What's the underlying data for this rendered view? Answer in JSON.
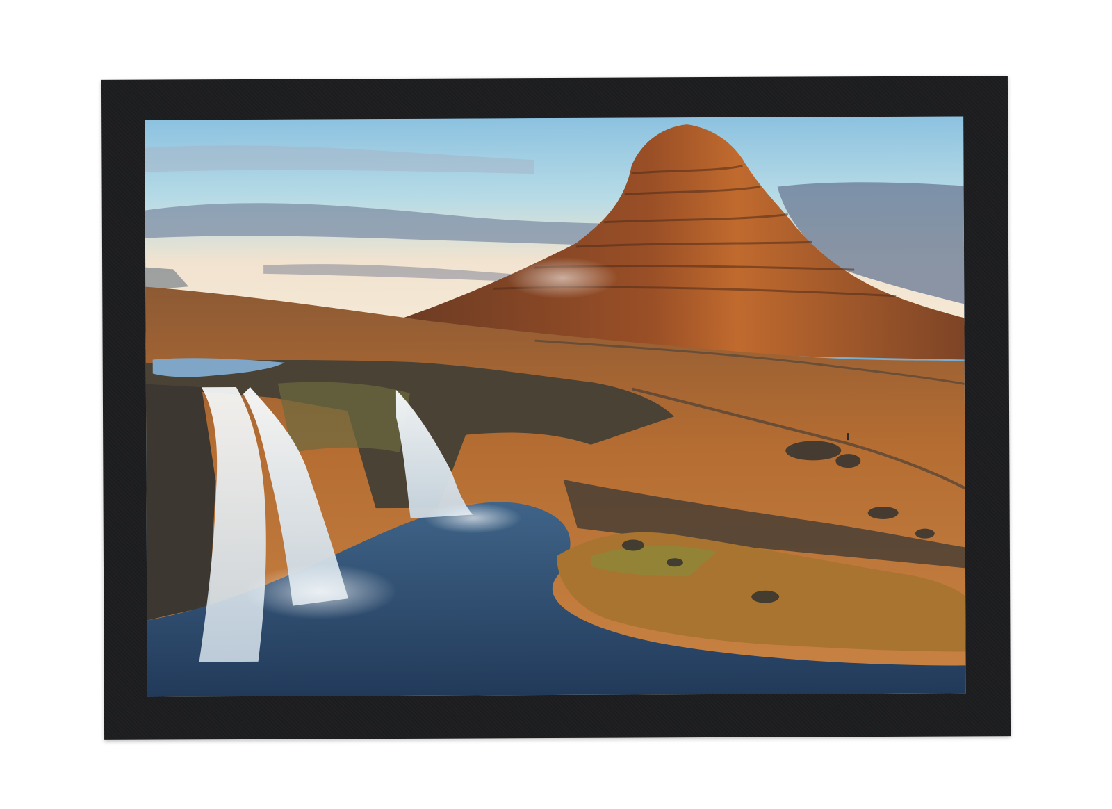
{
  "scene": {
    "subject": "framed-landscape-photo",
    "frame_color": "#1c1d1f",
    "colors": {
      "sky_top": "#8fc1de",
      "sky_horizon": "#f4e6d2",
      "mountain_lit": "#b8612c",
      "mountain_shadow": "#5a3322",
      "grass": "#b8722f",
      "water": "#2f4e73",
      "waterfall": "#eef3f6",
      "rock": "#3e3a32"
    }
  }
}
